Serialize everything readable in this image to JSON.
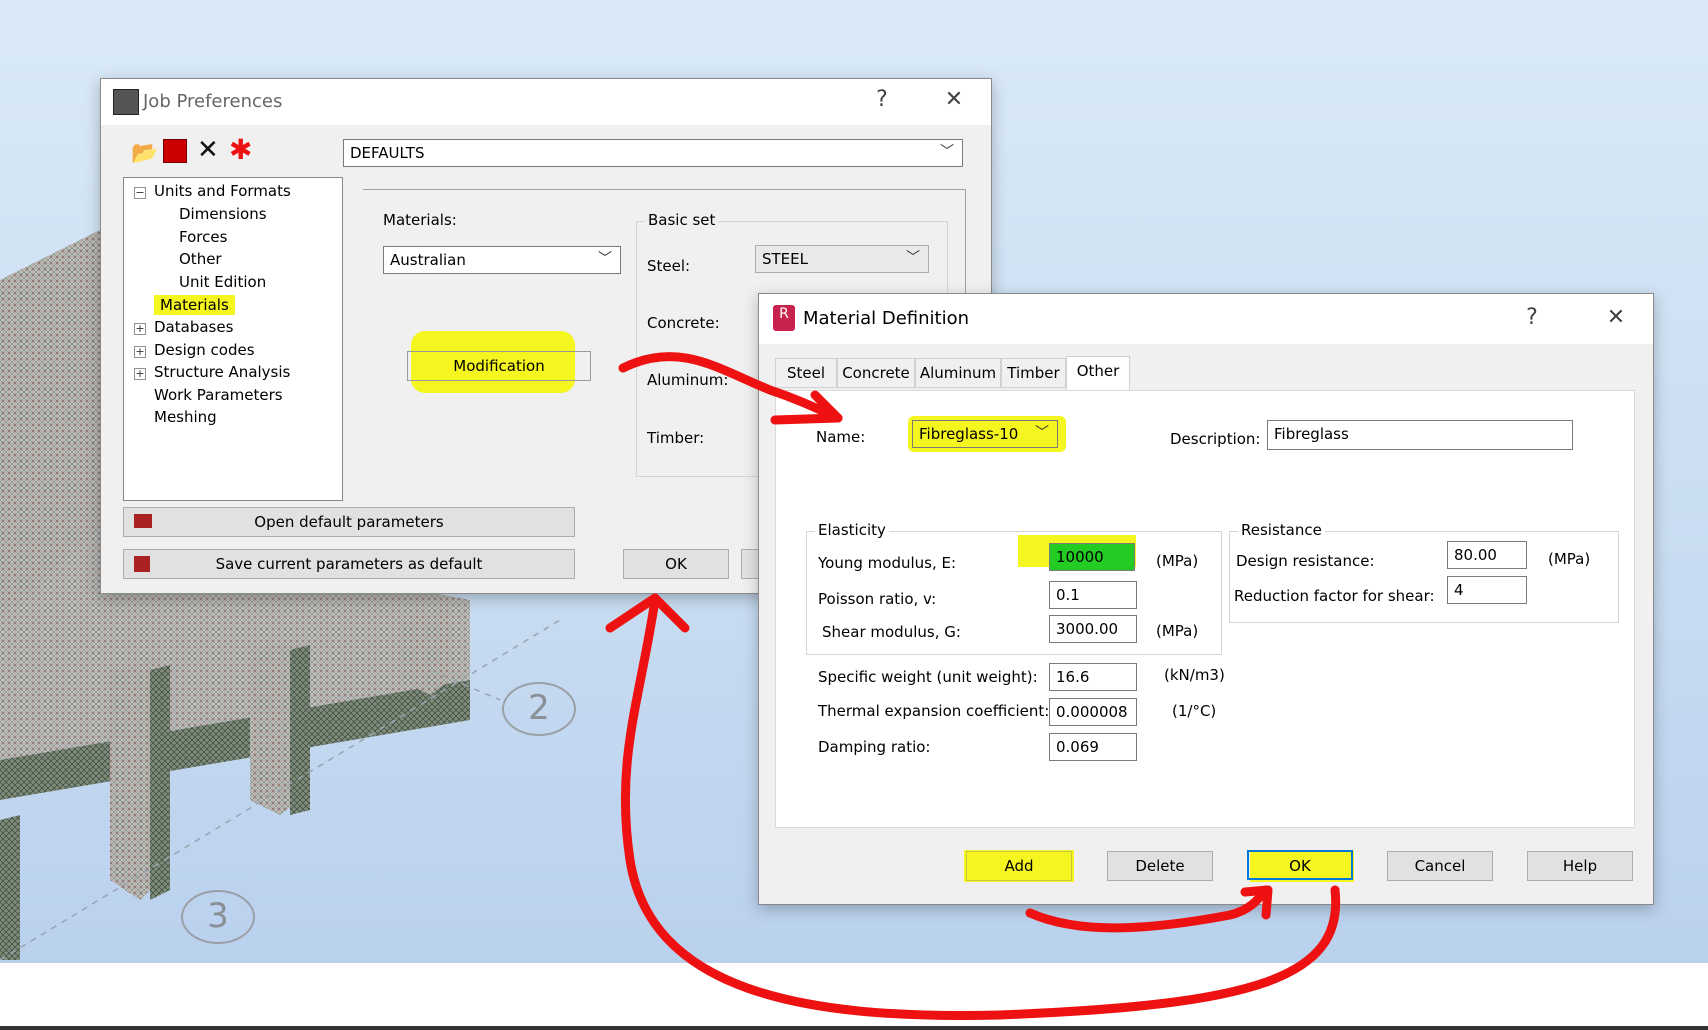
{
  "background": {
    "grid_label_2": "2",
    "grid_label_3": "3"
  },
  "job_prefs": {
    "title": "Job Preferences",
    "help_label": "?",
    "close_label": "✕",
    "preset_value": "DEFAULTS",
    "tree": {
      "units_and_formats": "Units and Formats",
      "dimensions": "Dimensions",
      "forces": "Forces",
      "other": "Other",
      "unit_edition": "Unit Edition",
      "materials": "Materials",
      "databases": "Databases",
      "design_codes": "Design codes",
      "structure_analysis": "Structure Analysis",
      "work_parameters": "Work Parameters",
      "meshing": "Meshing"
    },
    "materials_label": "Materials:",
    "materials_value": "Australian",
    "modification_label": "Modification",
    "basic_set_label": "Basic set",
    "steel_label": "Steel:",
    "steel_value": "STEEL",
    "concrete_label": "Concrete:",
    "aluminum_label": "Aluminum:",
    "timber_label": "Timber:",
    "open_default_label": "Open default parameters",
    "save_default_label": "Save current parameters as default",
    "ok_label": "OK"
  },
  "material_def": {
    "title": "Material Definition",
    "app_icon_text": "R",
    "help_label": "?",
    "close_label": "✕",
    "tabs": [
      "Steel",
      "Concrete",
      "Aluminum",
      "Timber",
      "Other"
    ],
    "name_label": "Name:",
    "name_value": "Fibreglass-10",
    "description_label": "Description:",
    "description_value": "Fibreglass",
    "elasticity": {
      "title": "Elasticity",
      "young_label": "Young modulus, E:",
      "young_value": "10000",
      "young_unit": "(MPa)",
      "poisson_label": "Poisson ratio, v:",
      "poisson_value": "0.1",
      "shear_label": "Shear modulus, G:",
      "shear_value": "3000.00",
      "shear_unit": "(MPa)"
    },
    "resistance": {
      "title": "Resistance",
      "design_label": "Design resistance:",
      "design_value": "80.00",
      "design_unit": "(MPa)",
      "shear_factor_label": "Reduction factor for shear:",
      "shear_factor_value": "4"
    },
    "specific_weight_label": "Specific weight (unit weight):",
    "specific_weight_value": "16.6",
    "specific_weight_unit": "(kN/m3)",
    "thermal_label": "Thermal expansion coefficient:",
    "thermal_value": "0.000008",
    "thermal_unit": "(1/°C)",
    "damping_label": "Damping ratio:",
    "damping_value": "0.069",
    "buttons": {
      "add": "Add",
      "delete": "Delete",
      "ok": "OK",
      "cancel": "Cancel",
      "help": "Help"
    }
  },
  "colors": {
    "highlight": "#f5f520",
    "annotation_red": "#ee1111",
    "young_field_green": "#22cc22"
  }
}
